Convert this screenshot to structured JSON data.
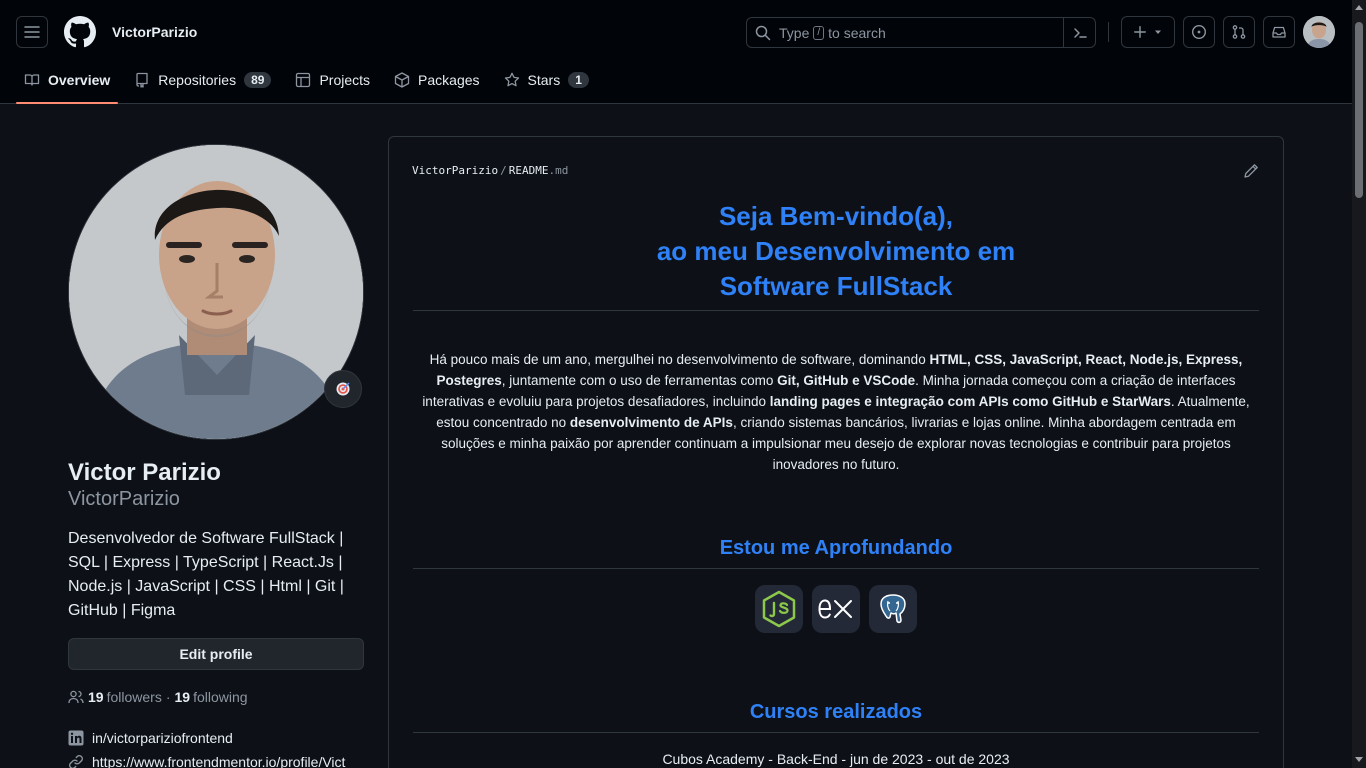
{
  "header": {
    "username": "VictorParizio",
    "search": {
      "prefix": "Type",
      "key": "/",
      "suffix": "to search"
    },
    "create_label": "+"
  },
  "tabs": [
    {
      "label": "Overview",
      "active": true
    },
    {
      "label": "Repositories",
      "count": "89"
    },
    {
      "label": "Projects"
    },
    {
      "label": "Packages"
    },
    {
      "label": "Stars",
      "count": "1"
    }
  ],
  "profile": {
    "name": "Victor Parizio",
    "login": "VictorParizio",
    "bio": "Desenvolvedor de Software FullStack | SQL | Express | TypeScript | React.Js | Node.js | JavaScript | CSS | Html | Git | GitHub | Figma",
    "edit_label": "Edit profile",
    "followers_count": "19",
    "followers_label": "followers",
    "separator": "·",
    "following_count": "19",
    "following_label": "following",
    "linkedin": "in/victorpariziofrontend",
    "website": "https://www.frontendmentor.io/profile/Vict"
  },
  "readme": {
    "path_owner": "VictorParizio",
    "path_sep": "/",
    "path_file": "README",
    "path_ext": ".md",
    "title_line1": "Seja Bem-vindo(a),",
    "title_line2": "ao meu Desenvolvimento em",
    "title_line3": "Software FullStack",
    "para": [
      {
        "t": "Há pouco mais de um ano, mergulhei no desenvolvimento de software, dominando "
      },
      {
        "b": "HTML, CSS, JavaScript, React, Node.js, Express, Postegres"
      },
      {
        "t": ", juntamente com o uso de ferramentas como "
      },
      {
        "b": "Git, GitHub e VSCode"
      },
      {
        "t": ". Minha jornada começou com a criação de interfaces interativas e evoluiu para projetos desafiadores, incluindo "
      },
      {
        "b": "landing pages e integração com APIs como GitHub e StarWars"
      },
      {
        "t": ". Atualmente, estou concentrado no "
      },
      {
        "b": "desenvolvimento de APIs"
      },
      {
        "t": ", criando sistemas bancários, livrarias e lojas online. Minha abordagem centrada em soluções e minha paixão por aprender continuam a impulsionar meu desejo de explorar novas tecnologias e contribuir para projetos inovadores no futuro."
      }
    ],
    "section1": "Estou me Aprofundando",
    "tech_icons": [
      "nodejs-icon",
      "express-icon",
      "postgresql-icon"
    ],
    "section2": "Cursos realizados",
    "course1": "Cubos Academy - Back-End - jun de 2023 - out de 2023"
  },
  "colors": {
    "accent_link": "#2f81f7",
    "tab_underline": "#fd8c73",
    "nodejs_green": "#8cc84b"
  }
}
